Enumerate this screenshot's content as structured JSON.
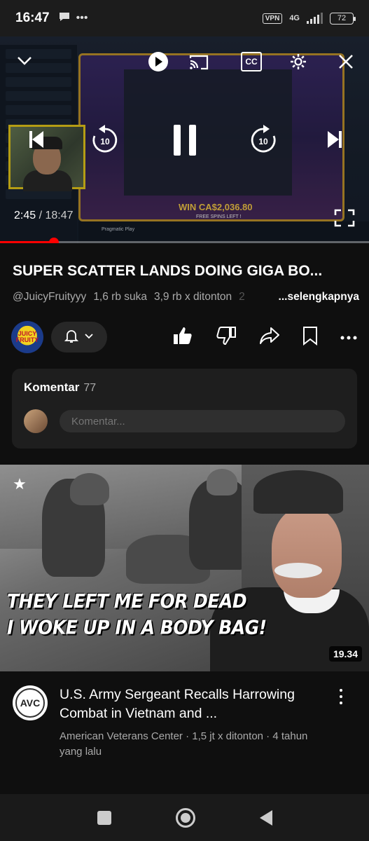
{
  "status_bar": {
    "time": "16:47",
    "left_icons": [
      "chat-bubble-icon",
      "more-dots-icon"
    ],
    "vpn": "VPN",
    "network": "4G",
    "battery": "72"
  },
  "player": {
    "current_time": "2:45",
    "separator": "/",
    "duration": "18:47",
    "progress_fraction": 0.146,
    "accent_color": "#ff0000",
    "stream_overlay": {
      "win_text": "WIN CA$2,036.80",
      "win_sub": "FREE SPINS LEFT !",
      "provider_text": "Pragmatic Play"
    },
    "controls": [
      "collapse-icon",
      "autoplay-toggle",
      "cast-icon",
      "captions-icon",
      "settings-icon",
      "close-icon",
      "previous-icon",
      "rewind-10-icon",
      "pause-icon",
      "forward-10-icon",
      "next-icon",
      "fullscreen-icon"
    ],
    "cc_label": "CC",
    "rewind_label": "10",
    "forward_label": "10"
  },
  "video": {
    "title": "SUPER SCATTER LANDS DOING GIGA BO...",
    "channel_handle": "@JuicyFruityyy",
    "likes": "1,6 rb suka",
    "views": "3,9 rb x ditonton",
    "age_fragment": "2",
    "more_label": "...selengkapnya",
    "channel_avatar_text": "JUICY FRUITY"
  },
  "comments": {
    "title": "Komentar",
    "count": "77",
    "placeholder": "Komentar..."
  },
  "recommended": {
    "thumbnail_caption_line1": "THEY LEFT ME FOR DEAD",
    "thumbnail_caption_line2": "I WOKE UP IN A BODY BAG!",
    "duration": "19.34",
    "title": "U.S. Army Sergeant Recalls Harrowing Combat in Vietnam and ...",
    "channel": "American Veterans Center",
    "views": "1,5 jt x ditonton",
    "age": "4 tahun yang lalu",
    "avatar_text": "AVC"
  }
}
